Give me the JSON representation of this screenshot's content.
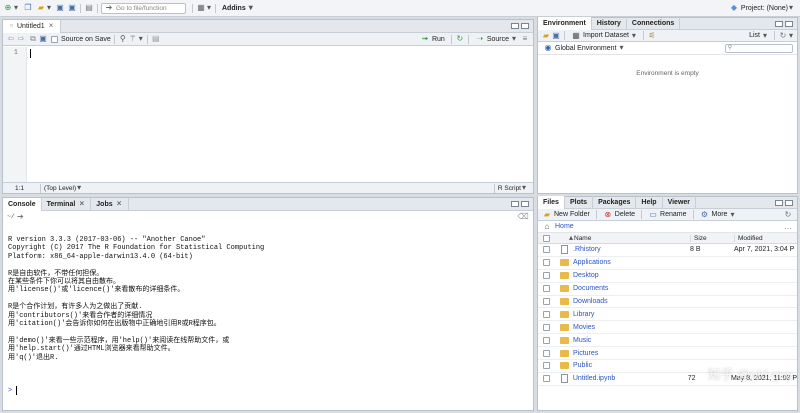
{
  "toolbar": {
    "goto_placeholder": "Go to file/function",
    "addins_label": "Addins",
    "project_label": "Project: (None)"
  },
  "editor": {
    "tab_label": "Untitled1",
    "source_on_save": "Source on Save",
    "run_label": "Run",
    "source_label": "Source",
    "line_number": "1",
    "status_pos": "1:1",
    "status_scope": "(Top Level)",
    "status_type": "R Script"
  },
  "console": {
    "tabs": [
      "Console",
      "Terminal",
      "Jobs"
    ],
    "path": "~/",
    "lines": [
      "R version 3.3.3 (2017-03-06) -- \"Another Canoe\"",
      "Copyright (C) 2017 The R Foundation for Statistical Computing",
      "Platform: x86_64-apple-darwin13.4.0 (64-bit)",
      "",
      "R是自由软件，不带任何担保。",
      "在某些条件下你可以将其自由散布。",
      "用'license()'或'licence()'来看散布的详细条件。",
      "",
      "R是个合作计划，有许多人为之做出了贡献.",
      "用'contributors()'来看合作者的详细情况",
      "用'citation()'会告诉你如何在出版物中正确地引用R或R程序包。",
      "",
      "用'demo()'来看一些示范程序，用'help()'来阅读在线帮助文件，或",
      "用'help.start()'通过HTML浏览器来看帮助文件。",
      "用'q()'退出R."
    ],
    "prompt": ">"
  },
  "environment": {
    "tabs": [
      "Environment",
      "History",
      "Connections"
    ],
    "import_label": "Import Dataset",
    "list_label": "List",
    "scope_label": "Global Environment",
    "empty_text": "Environment is empty"
  },
  "files": {
    "tabs": [
      "Files",
      "Plots",
      "Packages",
      "Help",
      "Viewer"
    ],
    "new_folder": "New Folder",
    "delete": "Delete",
    "rename": "Rename",
    "more": "More",
    "breadcrumb": "Home",
    "col_name": "Name",
    "col_size": "Size",
    "col_modified": "Modified",
    "rows": [
      {
        "name": ".Rhistory",
        "size": "8 B",
        "modified": "Apr 7, 2021, 3:04 P",
        "type": "file"
      },
      {
        "name": "Applications",
        "size": "",
        "modified": "",
        "type": "folder"
      },
      {
        "name": "Desktop",
        "size": "",
        "modified": "",
        "type": "folder"
      },
      {
        "name": "Documents",
        "size": "",
        "modified": "",
        "type": "folder"
      },
      {
        "name": "Downloads",
        "size": "",
        "modified": "",
        "type": "folder"
      },
      {
        "name": "Library",
        "size": "",
        "modified": "",
        "type": "folder"
      },
      {
        "name": "Movies",
        "size": "",
        "modified": "",
        "type": "folder"
      },
      {
        "name": "Music",
        "size": "",
        "modified": "",
        "type": "folder"
      },
      {
        "name": "Pictures",
        "size": "",
        "modified": "",
        "type": "folder"
      },
      {
        "name": "Public",
        "size": "",
        "modified": "",
        "type": "folder"
      },
      {
        "name": "Untitled.ipynb",
        "size": "72",
        "modified": "May 8, 2021, 11:03 P",
        "type": "file"
      }
    ]
  },
  "watermark": "知乎 @old-guy"
}
